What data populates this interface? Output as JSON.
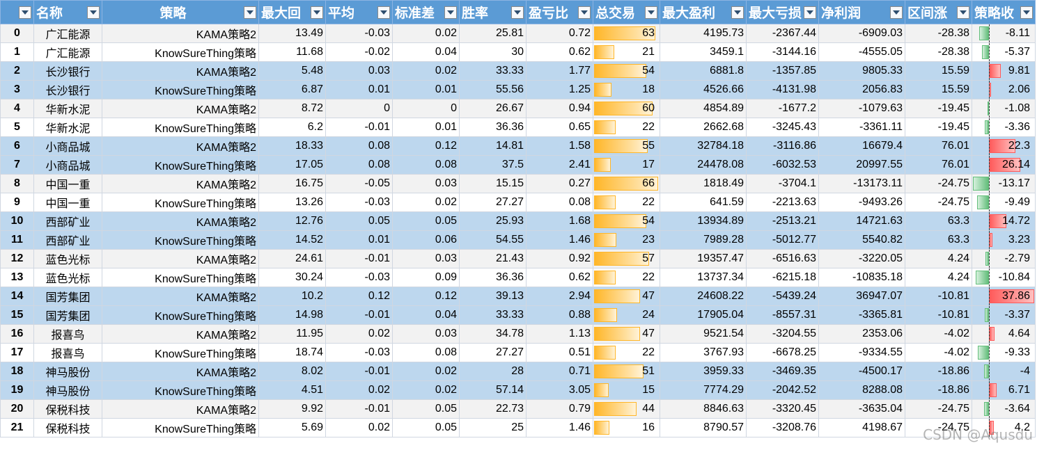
{
  "columns": [
    {
      "key": "index",
      "label": ""
    },
    {
      "key": "name",
      "label": "名称"
    },
    {
      "key": "strategy",
      "label": "策略"
    },
    {
      "key": "max_drawdown",
      "label": "最大回"
    },
    {
      "key": "avg",
      "label": "平均"
    },
    {
      "key": "std",
      "label": "标准差"
    },
    {
      "key": "win_rate",
      "label": "胜率"
    },
    {
      "key": "pl_ratio",
      "label": "盈亏比"
    },
    {
      "key": "trades",
      "label": "总交易"
    },
    {
      "key": "max_profit",
      "label": "最大盈利"
    },
    {
      "key": "max_loss",
      "label": "最大亏损"
    },
    {
      "key": "net_profit",
      "label": "净利润"
    },
    {
      "key": "interval_change",
      "label": "区间涨"
    },
    {
      "key": "strategy_return",
      "label": "策略收"
    }
  ],
  "rows": [
    {
      "index": "0",
      "name": "广汇能源",
      "strategy": "KAMA策略2",
      "max_drawdown": "13.49",
      "avg": "-0.03",
      "std": "0.02",
      "win_rate": "25.81",
      "pl_ratio": "0.72",
      "trades": "63",
      "max_profit": "4195.73",
      "max_loss": "-2367.44",
      "net_profit": "-6909.03",
      "interval_change": "-28.38",
      "strategy_return": "-8.11"
    },
    {
      "index": "1",
      "name": "广汇能源",
      "strategy": "KnowSureThing策略",
      "max_drawdown": "11.68",
      "avg": "-0.02",
      "std": "0.04",
      "win_rate": "30",
      "pl_ratio": "0.62",
      "trades": "21",
      "max_profit": "3459.1",
      "max_loss": "-3144.16",
      "net_profit": "-4555.05",
      "interval_change": "-28.38",
      "strategy_return": "-5.37"
    },
    {
      "index": "2",
      "name": "长沙银行",
      "strategy": "KAMA策略2",
      "max_drawdown": "5.48",
      "avg": "0.03",
      "std": "0.02",
      "win_rate": "33.33",
      "pl_ratio": "1.77",
      "trades": "54",
      "max_profit": "6881.8",
      "max_loss": "-1357.85",
      "net_profit": "9805.33",
      "interval_change": "15.59",
      "strategy_return": "9.81"
    },
    {
      "index": "3",
      "name": "长沙银行",
      "strategy": "KnowSureThing策略",
      "max_drawdown": "6.87",
      "avg": "0.01",
      "std": "0.01",
      "win_rate": "55.56",
      "pl_ratio": "1.25",
      "trades": "18",
      "max_profit": "4526.66",
      "max_loss": "-4131.98",
      "net_profit": "2056.83",
      "interval_change": "15.59",
      "strategy_return": "2.06"
    },
    {
      "index": "4",
      "name": "华新水泥",
      "strategy": "KAMA策略2",
      "max_drawdown": "8.72",
      "avg": "0",
      "std": "0",
      "win_rate": "26.67",
      "pl_ratio": "0.94",
      "trades": "60",
      "max_profit": "4854.89",
      "max_loss": "-1677.2",
      "net_profit": "-1079.63",
      "interval_change": "-19.45",
      "strategy_return": "-1.08"
    },
    {
      "index": "5",
      "name": "华新水泥",
      "strategy": "KnowSureThing策略",
      "max_drawdown": "6.2",
      "avg": "-0.01",
      "std": "0.01",
      "win_rate": "36.36",
      "pl_ratio": "0.65",
      "trades": "22",
      "max_profit": "2662.68",
      "max_loss": "-3245.43",
      "net_profit": "-3361.11",
      "interval_change": "-19.45",
      "strategy_return": "-3.36"
    },
    {
      "index": "6",
      "name": "小商品城",
      "strategy": "KAMA策略2",
      "max_drawdown": "18.33",
      "avg": "0.08",
      "std": "0.12",
      "win_rate": "14.81",
      "pl_ratio": "1.58",
      "trades": "55",
      "max_profit": "32784.18",
      "max_loss": "-3116.86",
      "net_profit": "16679.4",
      "interval_change": "76.01",
      "strategy_return": "22.3"
    },
    {
      "index": "7",
      "name": "小商品城",
      "strategy": "KnowSureThing策略",
      "max_drawdown": "17.05",
      "avg": "0.08",
      "std": "0.08",
      "win_rate": "37.5",
      "pl_ratio": "2.41",
      "trades": "17",
      "max_profit": "24478.08",
      "max_loss": "-6032.53",
      "net_profit": "20997.55",
      "interval_change": "76.01",
      "strategy_return": "26.14"
    },
    {
      "index": "8",
      "name": "中国一重",
      "strategy": "KAMA策略2",
      "max_drawdown": "16.75",
      "avg": "-0.05",
      "std": "0.03",
      "win_rate": "15.15",
      "pl_ratio": "0.27",
      "trades": "66",
      "max_profit": "1818.49",
      "max_loss": "-3704.1",
      "net_profit": "-13173.11",
      "interval_change": "-24.75",
      "strategy_return": "-13.17"
    },
    {
      "index": "9",
      "name": "中国一重",
      "strategy": "KnowSureThing策略",
      "max_drawdown": "13.26",
      "avg": "-0.03",
      "std": "0.02",
      "win_rate": "27.27",
      "pl_ratio": "0.08",
      "trades": "22",
      "max_profit": "641.59",
      "max_loss": "-2213.63",
      "net_profit": "-9493.26",
      "interval_change": "-24.75",
      "strategy_return": "-9.49"
    },
    {
      "index": "10",
      "name": "西部矿业",
      "strategy": "KAMA策略2",
      "max_drawdown": "12.76",
      "avg": "0.05",
      "std": "0.05",
      "win_rate": "25.93",
      "pl_ratio": "1.68",
      "trades": "54",
      "max_profit": "13934.89",
      "max_loss": "-2513.21",
      "net_profit": "14721.63",
      "interval_change": "63.3",
      "strategy_return": "14.72"
    },
    {
      "index": "11",
      "name": "西部矿业",
      "strategy": "KnowSureThing策略",
      "max_drawdown": "14.52",
      "avg": "0.01",
      "std": "0.06",
      "win_rate": "54.55",
      "pl_ratio": "1.46",
      "trades": "23",
      "max_profit": "7989.28",
      "max_loss": "-5012.77",
      "net_profit": "5540.82",
      "interval_change": "63.3",
      "strategy_return": "3.23"
    },
    {
      "index": "12",
      "name": "蓝色光标",
      "strategy": "KAMA策略2",
      "max_drawdown": "24.61",
      "avg": "-0.01",
      "std": "0.03",
      "win_rate": "21.43",
      "pl_ratio": "0.92",
      "trades": "57",
      "max_profit": "19357.47",
      "max_loss": "-6516.63",
      "net_profit": "-3220.05",
      "interval_change": "4.24",
      "strategy_return": "-2.79"
    },
    {
      "index": "13",
      "name": "蓝色光标",
      "strategy": "KnowSureThing策略",
      "max_drawdown": "30.24",
      "avg": "-0.03",
      "std": "0.09",
      "win_rate": "36.36",
      "pl_ratio": "0.62",
      "trades": "22",
      "max_profit": "13737.34",
      "max_loss": "-6215.18",
      "net_profit": "-10835.18",
      "interval_change": "4.24",
      "strategy_return": "-10.84"
    },
    {
      "index": "14",
      "name": "国芳集团",
      "strategy": "KAMA策略2",
      "max_drawdown": "10.2",
      "avg": "0.12",
      "std": "0.12",
      "win_rate": "39.13",
      "pl_ratio": "2.94",
      "trades": "47",
      "max_profit": "24608.22",
      "max_loss": "-5439.24",
      "net_profit": "36947.07",
      "interval_change": "-10.81",
      "strategy_return": "37.86"
    },
    {
      "index": "15",
      "name": "国芳集团",
      "strategy": "KnowSureThing策略",
      "max_drawdown": "14.98",
      "avg": "-0.01",
      "std": "0.04",
      "win_rate": "33.33",
      "pl_ratio": "0.88",
      "trades": "24",
      "max_profit": "17905.04",
      "max_loss": "-8557.31",
      "net_profit": "-3365.81",
      "interval_change": "-10.81",
      "strategy_return": "-3.37"
    },
    {
      "index": "16",
      "name": "报喜鸟",
      "strategy": "KAMA策略2",
      "max_drawdown": "11.95",
      "avg": "0.02",
      "std": "0.03",
      "win_rate": "34.78",
      "pl_ratio": "1.13",
      "trades": "47",
      "max_profit": "9521.54",
      "max_loss": "-3204.55",
      "net_profit": "2353.06",
      "interval_change": "-4.02",
      "strategy_return": "4.64"
    },
    {
      "index": "17",
      "name": "报喜鸟",
      "strategy": "KnowSureThing策略",
      "max_drawdown": "18.74",
      "avg": "-0.03",
      "std": "0.08",
      "win_rate": "27.27",
      "pl_ratio": "0.51",
      "trades": "22",
      "max_profit": "3767.93",
      "max_loss": "-6678.25",
      "net_profit": "-9334.55",
      "interval_change": "-4.02",
      "strategy_return": "-9.33"
    },
    {
      "index": "18",
      "name": "神马股份",
      "strategy": "KAMA策略2",
      "max_drawdown": "8.02",
      "avg": "-0.01",
      "std": "0.02",
      "win_rate": "28",
      "pl_ratio": "0.71",
      "trades": "51",
      "max_profit": "3959.33",
      "max_loss": "-3469.35",
      "net_profit": "-4500.17",
      "interval_change": "-18.86",
      "strategy_return": "-4"
    },
    {
      "index": "19",
      "name": "神马股份",
      "strategy": "KnowSureThing策略",
      "max_drawdown": "4.51",
      "avg": "0.02",
      "std": "0.02",
      "win_rate": "57.14",
      "pl_ratio": "3.05",
      "trades": "15",
      "max_profit": "7774.29",
      "max_loss": "-2042.52",
      "net_profit": "8288.08",
      "interval_change": "-18.86",
      "strategy_return": "6.71"
    },
    {
      "index": "20",
      "name": "保税科技",
      "strategy": "KAMA策略2",
      "max_drawdown": "9.92",
      "avg": "-0.01",
      "std": "0.05",
      "win_rate": "22.73",
      "pl_ratio": "0.79",
      "trades": "44",
      "max_profit": "8846.63",
      "max_loss": "-3320.45",
      "net_profit": "-3635.04",
      "interval_change": "-24.75",
      "strategy_return": "-3.64"
    },
    {
      "index": "21",
      "name": "保税科技",
      "strategy": "KnowSureThing策略",
      "max_drawdown": "5.69",
      "avg": "0.02",
      "std": "0.05",
      "win_rate": "25",
      "pl_ratio": "1.46",
      "trades": "16",
      "max_profit": "8790.57",
      "max_loss": "-3208.76",
      "net_profit": "4198.67",
      "interval_change": "-24.75",
      "strategy_return": "4.2"
    }
  ],
  "row_colors": [
    "grey",
    "white",
    "blue",
    "blue",
    "grey",
    "white",
    "blue",
    "blue",
    "grey",
    "white",
    "blue",
    "blue",
    "grey",
    "white",
    "blue",
    "blue",
    "grey",
    "white",
    "blue",
    "blue",
    "grey",
    "white"
  ],
  "databar_colors": {
    "trades": "#ffb628",
    "positive": "#ff5a5a",
    "negative": "#63be7b"
  },
  "watermark": "CSDN @Aqusdu"
}
